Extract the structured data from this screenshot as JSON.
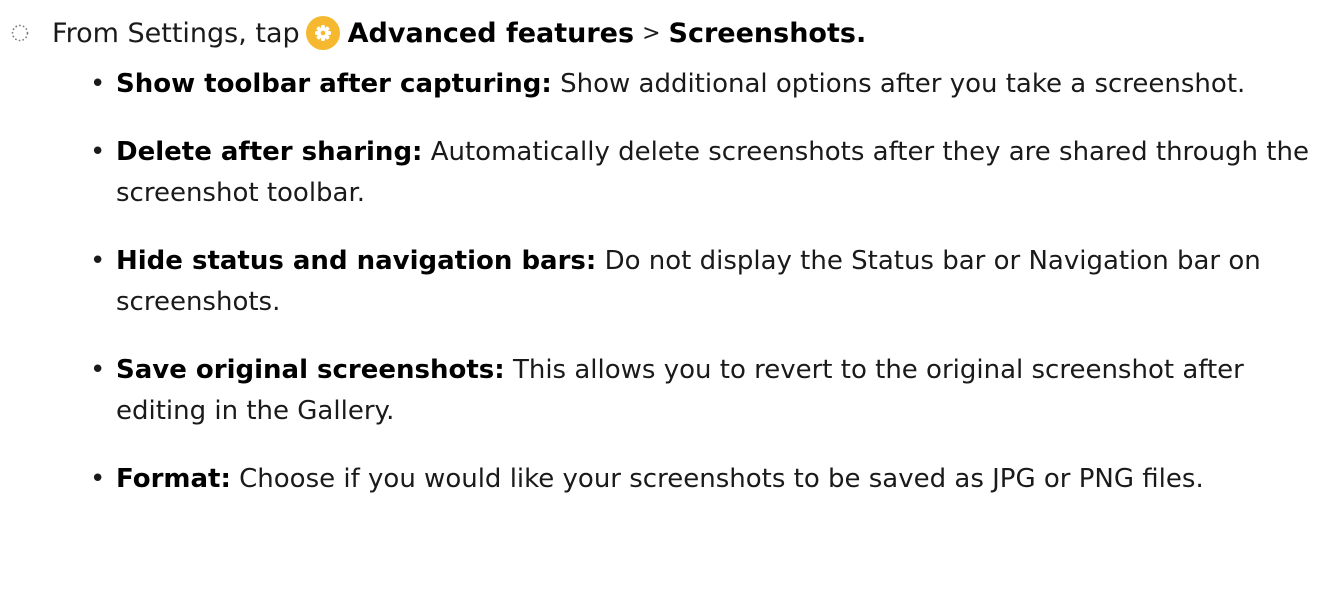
{
  "step": {
    "prefix": "From Settings, tap",
    "path": [
      "Advanced features",
      "Screenshots."
    ],
    "separator": ">",
    "icon": "settings-gear-icon",
    "icon_color": "#f5b82e"
  },
  "items": [
    {
      "term": "Show toolbar after capturing:",
      "desc": "Show additional options after you take a screenshot."
    },
    {
      "term": "Delete after sharing:",
      "desc": "Automatically delete screenshots after they are shared through the screenshot toolbar."
    },
    {
      "term": "Hide status and navigation bars:",
      "desc": "Do not display the Status bar or Navigation bar on screenshots."
    },
    {
      "term": "Save original screenshots:",
      "desc": "This allows you to revert to the original screenshot after editing in the Gallery."
    },
    {
      "term": "Format:",
      "desc": "Choose if you would like your screenshots to be saved as JPG or PNG files."
    }
  ]
}
